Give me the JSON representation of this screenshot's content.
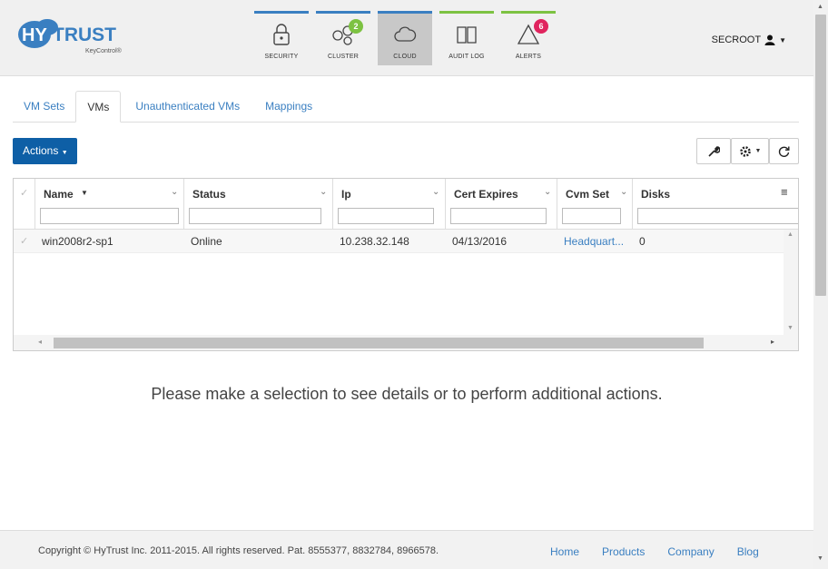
{
  "brand": {
    "name": "HYTRUST",
    "product": "KeyControl®",
    "color": "#3a7fc1"
  },
  "nav": [
    {
      "key": "security",
      "label": "SECURITY",
      "icon": "lock-icon"
    },
    {
      "key": "cluster",
      "label": "CLUSTER",
      "icon": "cluster-icon",
      "badge": "2"
    },
    {
      "key": "cloud",
      "label": "CLOUD",
      "icon": "cloud-icon",
      "active": true
    },
    {
      "key": "audit",
      "label": "AUDIT LOG",
      "icon": "book-icon"
    },
    {
      "key": "alerts",
      "label": "ALERTS",
      "icon": "warning-icon",
      "badge": "6"
    }
  ],
  "user": {
    "name": "SECROOT",
    "icon": "user-icon"
  },
  "tabs": [
    {
      "label": "VM Sets"
    },
    {
      "label": "VMs",
      "active": true
    },
    {
      "label": "Unauthenticated VMs"
    },
    {
      "label": "Mappings"
    }
  ],
  "toolbar": {
    "actions_label": "Actions",
    "tools": [
      "wrench-icon",
      "gear-icon",
      "refresh-icon"
    ]
  },
  "grid": {
    "columns": [
      "Name",
      "Status",
      "Ip",
      "Cert Expires",
      "Cvm Set",
      "Disks"
    ],
    "rows": [
      [
        "win2008r2-sp1",
        "Online",
        "10.238.32.148",
        "04/13/2016",
        "Headquart...",
        "0"
      ]
    ]
  },
  "message": "Please make a selection to see details or to perform additional actions.",
  "footer": {
    "copyright": "Copyright © HyTrust Inc. 2011-2015. All rights reserved. Pat. 8555377, 8832784, 8966578.",
    "links": [
      "Home",
      "Products",
      "Company",
      "Blog"
    ]
  }
}
